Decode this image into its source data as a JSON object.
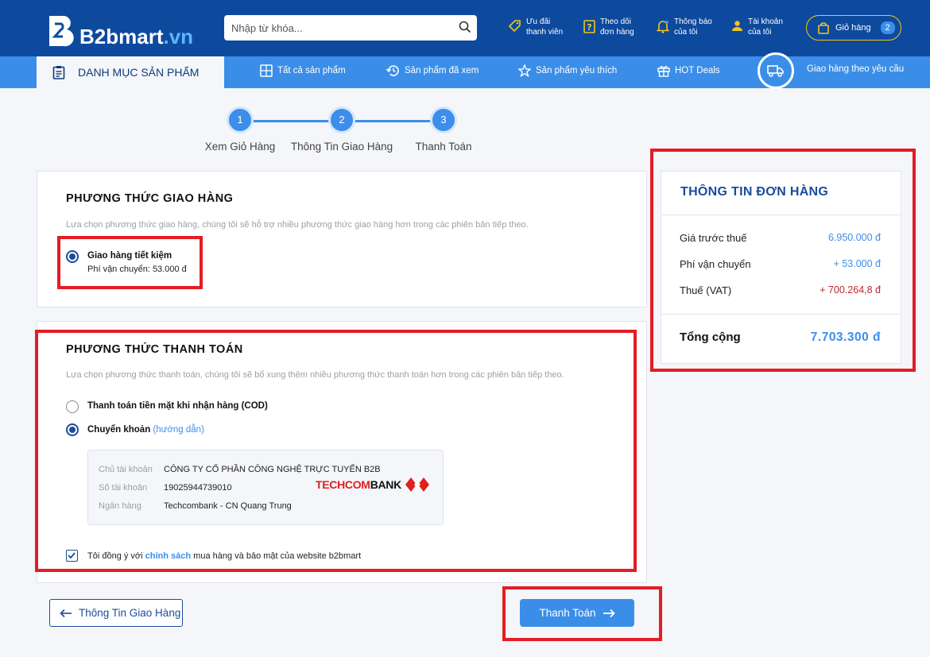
{
  "header": {
    "logo_main": "B2bmart",
    "logo_suffix": ".vn",
    "search_placeholder": "Nhập từ khóa...",
    "links": [
      {
        "line1": "Ưu đãi",
        "line2": "thanh viên",
        "icon": "tag-icon"
      },
      {
        "line1": "Theo dõi",
        "line2": "đơn hàng",
        "icon": "question-doc-icon"
      },
      {
        "line1": "Thông báo",
        "line2": "của tôi",
        "icon": "bell-icon"
      },
      {
        "line1": "Tài khoản",
        "line2": "của tôi",
        "icon": "user-icon"
      }
    ],
    "cart_label": "Giỏ hàng",
    "cart_count": "2"
  },
  "nav": {
    "category_label": "DANH MỤC SẢN PHẨM",
    "items": [
      {
        "label": "Tất cả sản phẩm",
        "icon": "grid-plus-icon"
      },
      {
        "label": "Sản phẩm đã xem",
        "icon": "history-icon"
      },
      {
        "label": "Sản phẩm yêu thích",
        "icon": "star-icon"
      },
      {
        "label": "HOT Deals",
        "icon": "gift-icon"
      },
      {
        "label": "Giao hàng theo yêu cầu",
        "icon": "truck-icon"
      }
    ]
  },
  "steps": [
    {
      "number": "1",
      "label": "Xem Giỏ Hàng"
    },
    {
      "number": "2",
      "label": "Thông Tin Giao Hàng"
    },
    {
      "number": "3",
      "label": "Thanh Toán"
    }
  ],
  "shipping": {
    "title": "PHƯƠNG THỨC GIAO HÀNG",
    "description": "Lựa chọn phương thức giao hàng, chúng tôi sẽ hỗ trợ nhiều phương thức giao hàng hơn trong các phiên bản tiếp theo.",
    "option_label": "Giao hàng tiết kiệm",
    "option_fee": "Phí vận chuyển: 53.000 đ"
  },
  "payment": {
    "title": "PHƯƠNG THỨC THANH TOÁN",
    "description": "Lựa chọn phương thức thanh toán, chúng tôi sẽ bổ xung thêm nhiều phương thức thanh toán hơn trong các phiên bản tiếp theo.",
    "cod_label": "Thanh toán tiền mặt khi nhận hàng (COD)",
    "transfer_label": "Chuyển khoản",
    "transfer_guide": "(hướng dẫn)",
    "bank": {
      "owner_label": "Chủ tài khoản",
      "owner_value": "CÔNG TY CỔ PHẦN CÔNG NGHỆ TRỰC TUYẾN B2B",
      "account_label": "Số tài khoản",
      "account_value": "19025944739010",
      "bank_label": "Ngân hàng",
      "bank_value": "Techcombank - CN Quang Trung",
      "logo_text_a": "TECHCOM",
      "logo_text_b": "BANK"
    },
    "agree_prefix": "Tôi đồng ý với",
    "agree_link": "chính sách",
    "agree_suffix": "mua hàng và bảo mật của website b2bmart",
    "agree_checked": true
  },
  "summary": {
    "title": "THÔNG TIN ĐƠN HÀNG",
    "rows": [
      {
        "label": "Giá trước thuế",
        "value": "6.950.000 đ",
        "color": "#3d8eea"
      },
      {
        "label": "Phí vận chuyển",
        "value": "+ 53.000 đ",
        "color": "#3d8eea"
      },
      {
        "label": "Thuế (VAT)",
        "value": "+ 700.264,8 đ",
        "color": "#c0262c"
      }
    ],
    "total_label": "Tổng cộng",
    "total_value": "7.703.300 đ"
  },
  "actions": {
    "back_label": "Thông Tin Giao Hàng",
    "pay_label": "Thanh Toán"
  },
  "colors": {
    "brand_dark": "#0d4a9e",
    "brand_light": "#3b8ee8",
    "highlight_red": "#e41c24"
  }
}
